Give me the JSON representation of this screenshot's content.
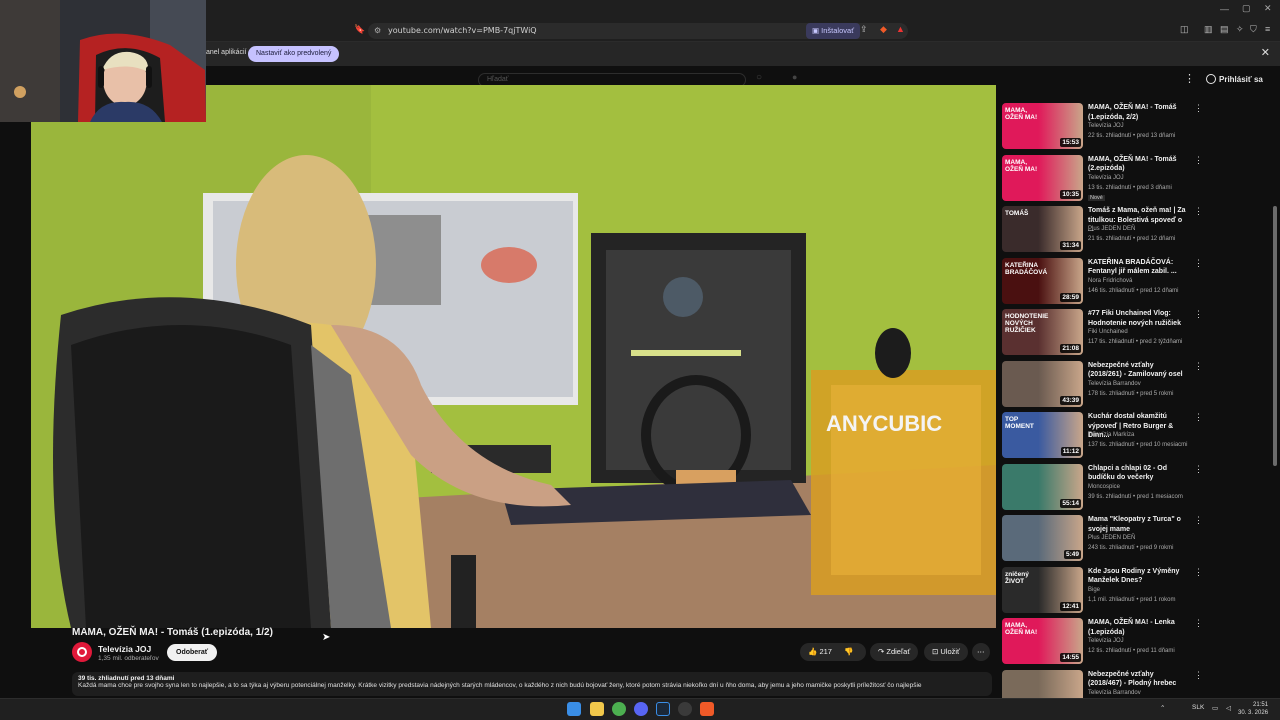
{
  "browser": {
    "url": "youtube.com/watch?v=PMB-7qjTWiQ",
    "install_label": "Inštalovať",
    "infobar_text": "anel aplikácií",
    "default_label": "Nastaviť ako predvolený"
  },
  "youtube": {
    "search_placeholder": "Hľadať",
    "signin_label": "Prihlásiť sa"
  },
  "video": {
    "overlay_text": "ANYCUBIC",
    "title": "MAMA, OŽEŇ MA! - Tomáš (1.epizóda, 1/2)",
    "channel": "Televízia JOJ",
    "subscribers": "1,35 mil. odberateľov",
    "subscribe_label": "Odoberať",
    "likes": "217",
    "share_label": "Zdieľať",
    "save_label": "Uložiť",
    "description_meta": "39 tis. zhliadnutí  pred 13 dňami",
    "description": "Každá mama chce pre svojho syna len to najlepšie, a to sa týka aj výberu potenciálnej manželky. Krátke vizitky predstavia nádejných starých mládencov, o každého z nich budú bojovať ženy, ktoré potom strávia niekoľko dní u ňho doma, aby jemu a jeho mamičke poskytli príležitosť čo najlepšie"
  },
  "recommendations": [
    {
      "title": "MAMA, OŽEŇ MA! - Tomáš (1.epizóda, 2/2)",
      "channel": "Televízia JOJ",
      "meta": "22 tis. zhliadnutí • pred 13 dňami",
      "duration": "15:53",
      "thumb_color": "#e0195a",
      "thumb_text": "MAMA, OŽEŇ MA!"
    },
    {
      "title": "MAMA, OŽEŇ MA! - Tomáš (2.epizóda)",
      "channel": "Televízia JOJ",
      "meta": "13 tis. zhliadnutí • pred 3 dňami",
      "badge": "Nové",
      "duration": "10:35",
      "thumb_color": "#e0195a",
      "thumb_text": "MAMA, OŽEŇ MA!"
    },
    {
      "title": "Tomáš z Mama, ožeň ma! | Za titulkou: Bolestivá spoveď o ...",
      "channel": "Plus JEDEN DEŇ",
      "meta": "21 tis. zhliadnutí • pred 12 dňami",
      "duration": "31:34",
      "thumb_color": "#3a2b2b",
      "thumb_text": "TOMÁŠ"
    },
    {
      "title": "KATEŘINA BRADÁČOVÁ: Fentanyl jiř málem zabil. ...",
      "channel": "Nora Fridrichová",
      "meta": "146 tis. zhliadnutí • pred 12 dňami",
      "duration": "28:59",
      "thumb_color": "#4a1010",
      "thumb_text": "KATEŘINA BRADÁČOVÁ"
    },
    {
      "title": "#77 Fiki Unchained Vlog: Hodnotenie nových ružičiek",
      "channel": "Fiki Unchained",
      "meta": "117 tis. zhliadnutí • pred 2 týždňami",
      "duration": "21:08",
      "thumb_color": "#5a3030",
      "thumb_text": "HODNOTENIE NOVÝCH RUŽIČIEK"
    },
    {
      "title": "Nebezpečné vzťahy (2018/261) - Zamilovaný osel",
      "channel": "Televízia Barrandov",
      "meta": "178 tis. zhliadnutí • pred 5 rokmi",
      "duration": "43:39",
      "thumb_color": "#6a5a50",
      "thumb_text": ""
    },
    {
      "title": "Kuchár dostal okamžitú výpoveď | Retro Burger & Dinn...",
      "channel": "Televízia Markíza",
      "meta": "137 tis. zhliadnutí • pred 10 mesiacmi",
      "duration": "11:12",
      "thumb_color": "#3a5aa0",
      "thumb_text": "TOP MOMENT"
    },
    {
      "title": "Chlapci a chlapi 02 - Od budíčku do večerky",
      "channel": "Moncospice",
      "meta": "39 tis. zhliadnutí • pred 1 mesiacom",
      "duration": "55:14",
      "thumb_color": "#3a7a6a",
      "thumb_text": ""
    },
    {
      "title": "Mama \"Kleopatry z Turca\" o svojej mame",
      "channel": "Plus JEDEN DEŇ",
      "meta": "243 tis. zhliadnutí • pred 9 rokmi",
      "duration": "5:49",
      "thumb_color": "#5a6a7a",
      "thumb_text": ""
    },
    {
      "title": "Kde Jsou Rodiny z Výměny Manželek Dnes?",
      "channel": "Bige",
      "meta": "1,1 mil. zhliadnutí • pred 1 rokom",
      "duration": "12:41",
      "thumb_color": "#2a2a2a",
      "thumb_text": "zničený ŽIVOT"
    },
    {
      "title": "MAMA, OŽEŇ MA! - Lenka (1.epizóda)",
      "channel": "Televízia JOJ",
      "meta": "12 tis. zhliadnutí • pred 11 dňami",
      "duration": "14:55",
      "thumb_color": "#e0195a",
      "thumb_text": "MAMA, OŽEŇ MA!"
    },
    {
      "title": "Nebezpečné vzťahy (2018/467) - Plodný hrebec",
      "channel": "Televízia Barrandov",
      "meta": "",
      "duration": "",
      "thumb_color": "#7a6a5a",
      "thumb_text": ""
    }
  ],
  "taskbar": {
    "lang": "SLK",
    "time": "21:51",
    "date": "30. 3. 2026"
  }
}
